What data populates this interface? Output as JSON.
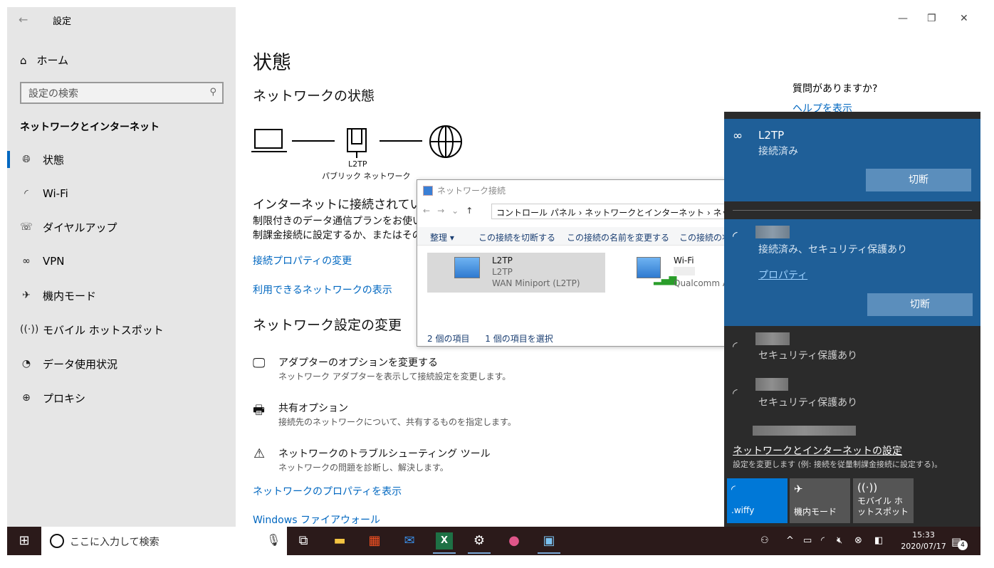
{
  "window": {
    "title": "設定",
    "minimize": "—",
    "restore": "❐",
    "close": "✕"
  },
  "sidebar": {
    "home": "ホーム",
    "search_placeholder": "設定の検索",
    "section": "ネットワークとインターネット",
    "items": [
      {
        "label": "状態",
        "icon": "globe-icon"
      },
      {
        "label": "Wi-Fi",
        "icon": "wifi-icon"
      },
      {
        "label": "ダイヤルアップ",
        "icon": "dialup-icon"
      },
      {
        "label": "VPN",
        "icon": "vpn-icon"
      },
      {
        "label": "機内モード",
        "icon": "airplane-icon"
      },
      {
        "label": "モバイル ホットスポット",
        "icon": "hotspot-icon"
      },
      {
        "label": "データ使用状況",
        "icon": "data-usage-icon"
      },
      {
        "label": "プロキシ",
        "icon": "proxy-globe-icon"
      }
    ]
  },
  "main": {
    "title": "状態",
    "network_status_heading": "ネットワークの状態",
    "diagram": {
      "node_label": "L2TP",
      "node_sub": "パブリック ネットワーク"
    },
    "connected_heading": "インターネットに接続されています",
    "desc_line1": "制限付きのデータ通信プランをお使いの場",
    "desc_line2": "制課金接続に設定するか、またはその他",
    "link_props": "接続プロパティの変更",
    "link_networks": "利用できるネットワークの表示",
    "change_heading": "ネットワーク設定の変更",
    "options": [
      {
        "title": "アダプターのオプションを変更する",
        "sub": "ネットワーク アダプターを表示して接続設定を変更します。"
      },
      {
        "title": "共有オプション",
        "sub": "接続先のネットワークについて、共有するものを指定します。"
      },
      {
        "title": "ネットワークのトラブルシューティング ツール",
        "sub": "ネットワークの問題を診断し、解決します。"
      }
    ],
    "link_net_props": "ネットワークのプロパティを表示",
    "link_firewall": "Windows ファイアウォール",
    "help_q": "質問がありますか?",
    "help_link": "ヘルプを表示"
  },
  "explorer": {
    "title": "ネットワーク接続",
    "address": "コントロール パネル  ›  ネットワークとインターネット  ›  ネットワ",
    "toolbar": [
      "整理 ▾",
      "この接続を切断する",
      "この接続の名前を変更する",
      "この接続の状"
    ],
    "items": [
      {
        "name": "L2TP",
        "line2": "L2TP",
        "line3": "WAN Miniport (L2TP)"
      },
      {
        "name": "Wi-Fi",
        "line2": "",
        "line3": "Qualcomm At"
      }
    ],
    "status_count": "2 個の項目",
    "status_selected": "1 個の項目を選択"
  },
  "flyout": {
    "vpn_name": "L2TP",
    "vpn_status": "接続済み",
    "disconnect": "切断",
    "wifi_status": "接続済み、セキュリティ保護あり",
    "properties": "プロパティ",
    "secured": "セキュリティ保護あり",
    "settings_link": "ネットワークとインターネットの設定",
    "settings_sub": "設定を変更します (例: 接続を従量制課金接続に設定する)。",
    "tiles": [
      {
        "label": ".wiffy",
        "icon": "wifi-icon",
        "active": true
      },
      {
        "label": "機内モード",
        "icon": "airplane-icon",
        "active": false
      },
      {
        "label": "モバイル ホットスポット",
        "icon": "hotspot-icon",
        "active": false
      }
    ]
  },
  "taskbar": {
    "search_placeholder": "ここに入力して検索",
    "time": "15:33",
    "date": "2020/07/17",
    "notif_count": "4"
  },
  "colors": {
    "accent": "#0067c0",
    "flyout_card": "#1f5f98",
    "tile_active": "#0078d7"
  }
}
